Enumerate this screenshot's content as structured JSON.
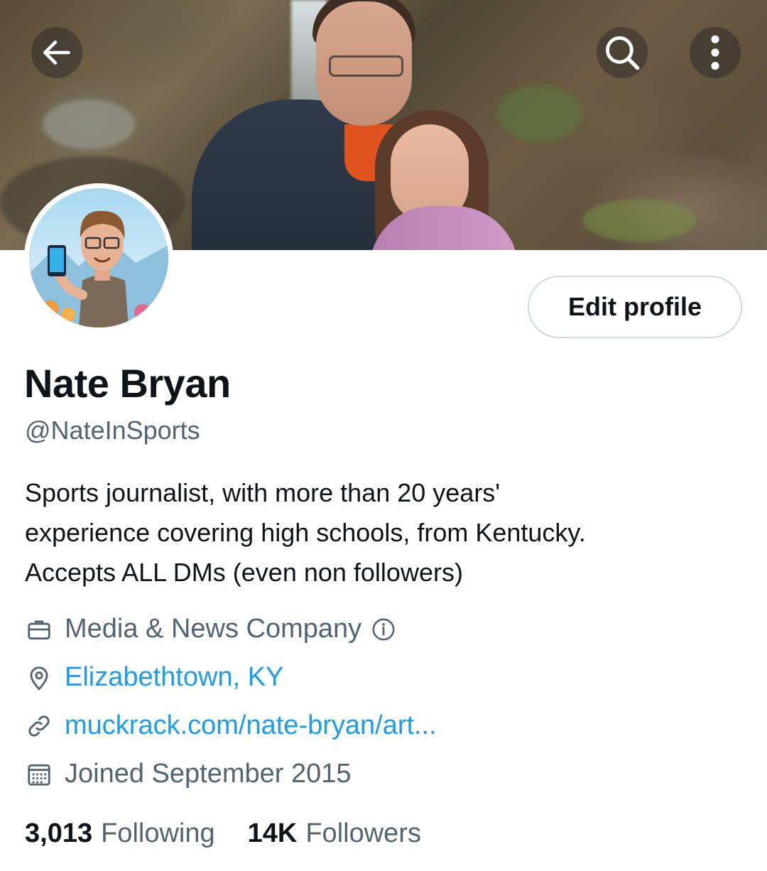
{
  "header": {
    "back_icon": "arrow-left-icon",
    "search_icon": "search-icon",
    "more_icon": "more-vertical-icon"
  },
  "profile": {
    "name": "Nate Bryan",
    "handle": "@NateInSports",
    "bio": "Sports journalist, with more than 20 years'\nexperience covering high schools, from Kentucky.\nAccepts ALL DMs (even non followers)",
    "edit_button_label": "Edit profile",
    "category": "Media & News Company",
    "location": "Elizabethtown, KY",
    "website": "muckrack.com/nate-bryan/art...",
    "joined": "Joined September 2015"
  },
  "stats": {
    "following_count": "3,013",
    "following_label": "Following",
    "followers_count": "14K",
    "followers_label": "Followers"
  },
  "colors": {
    "link": "#1d9bf0",
    "secondary_text": "#536471",
    "primary_text": "#0f1419"
  }
}
